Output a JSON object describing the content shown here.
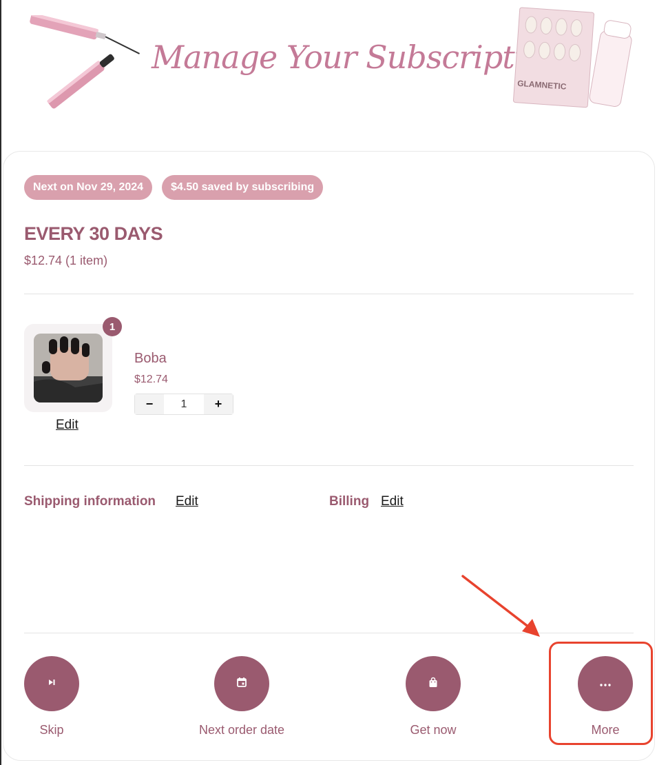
{
  "banner": {
    "title": "Manage Your Subscriptions",
    "brand": "GLAMNETIC"
  },
  "subscription": {
    "badges": [
      "Next on Nov 29, 2024",
      "$4.50 saved by subscribing"
    ],
    "frequency": "EVERY 30 DAYS",
    "total": "$12.74 (1 item)"
  },
  "product": {
    "name": "Boba",
    "price": "$12.74",
    "quantity": "1",
    "count_badge": "1",
    "edit_label": "Edit",
    "decrement": "−",
    "increment": "+"
  },
  "shipping": {
    "label": "Shipping information",
    "edit_label": "Edit"
  },
  "billing": {
    "label": "Billing",
    "edit_label": "Edit"
  },
  "actions": [
    {
      "label": "Skip",
      "icon": "skip-icon"
    },
    {
      "label": "Next order date",
      "icon": "calendar-icon"
    },
    {
      "label": "Get now",
      "icon": "shopping-bag-icon"
    },
    {
      "label": "More",
      "icon": "more-icon"
    }
  ],
  "colors": {
    "accent": "#9a5a6f",
    "badge": "#d9a0ad",
    "annotation": "#e8432e"
  }
}
